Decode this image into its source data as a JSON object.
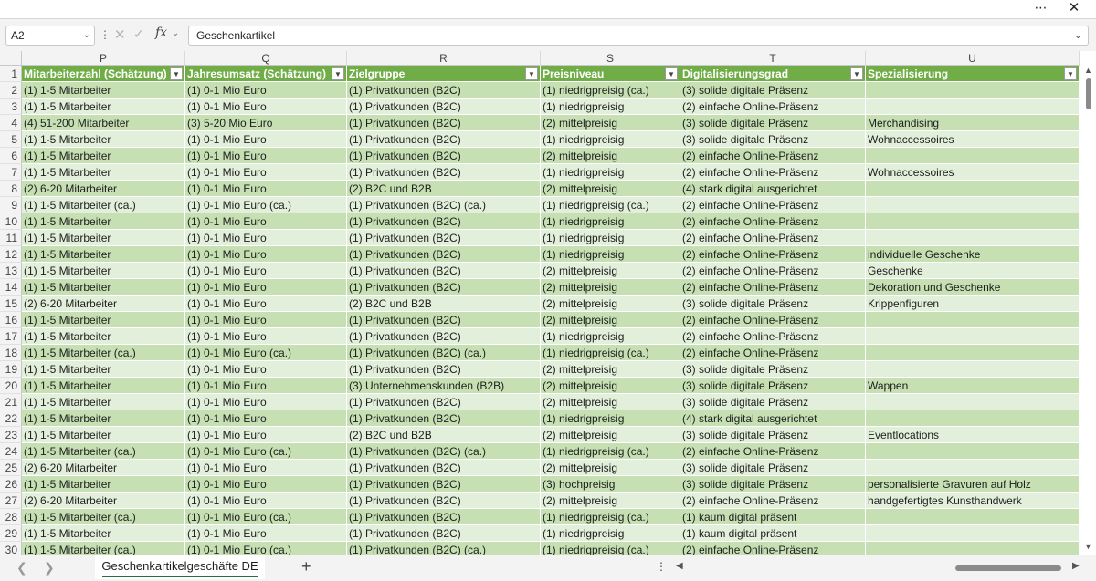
{
  "window": {
    "more_icon": "⋯",
    "close_icon": "✕"
  },
  "formula_bar": {
    "name_box": "A2",
    "fx_label": "fx",
    "content": "Geschenkartikel"
  },
  "columns": [
    "P",
    "Q",
    "R",
    "S",
    "T",
    "U"
  ],
  "headers": [
    "Mitarbeiterzahl (Schätzung)",
    "Jahresumsatz (Schätzung)",
    "Zielgruppe",
    "Preisniveau",
    "Digitalisierungsgrad",
    "Spezialisierung"
  ],
  "rows": [
    {
      "n": "2",
      "c": [
        "(1) 1-5 Mitarbeiter",
        "(1) 0-1 Mio Euro",
        "(1) Privatkunden (B2C)",
        "(1) niedrigpreisig (ca.)",
        "(3) solide digitale Präsenz",
        ""
      ]
    },
    {
      "n": "3",
      "c": [
        "(1) 1-5 Mitarbeiter",
        "(1) 0-1 Mio Euro",
        "(1) Privatkunden (B2C)",
        "(1) niedrigpreisig",
        "(2) einfache Online-Präsenz",
        ""
      ]
    },
    {
      "n": "4",
      "c": [
        "(4) 51-200 Mitarbeiter",
        "(3) 5-20 Mio Euro",
        "(1) Privatkunden (B2C)",
        "(2) mittelpreisig",
        "(3) solide digitale Präsenz",
        "Merchandising"
      ]
    },
    {
      "n": "5",
      "c": [
        "(1) 1-5 Mitarbeiter",
        "(1) 0-1 Mio Euro",
        "(1) Privatkunden (B2C)",
        "(1) niedrigpreisig",
        "(3) solide digitale Präsenz",
        "Wohnaccessoires"
      ]
    },
    {
      "n": "6",
      "c": [
        "(1) 1-5 Mitarbeiter",
        "(1) 0-1 Mio Euro",
        "(1) Privatkunden (B2C)",
        "(2) mittelpreisig",
        "(2) einfache Online-Präsenz",
        ""
      ]
    },
    {
      "n": "7",
      "c": [
        "(1) 1-5 Mitarbeiter",
        "(1) 0-1 Mio Euro",
        "(1) Privatkunden (B2C)",
        "(1) niedrigpreisig",
        "(2) einfache Online-Präsenz",
        "Wohnaccessoires"
      ]
    },
    {
      "n": "8",
      "c": [
        "(2) 6-20 Mitarbeiter",
        "(1) 0-1 Mio Euro",
        "(2) B2C und B2B",
        "(2) mittelpreisig",
        "(4) stark digital ausgerichtet",
        ""
      ]
    },
    {
      "n": "9",
      "c": [
        "(1) 1-5 Mitarbeiter (ca.)",
        "(1) 0-1 Mio Euro (ca.)",
        "(1) Privatkunden (B2C) (ca.)",
        "(1) niedrigpreisig (ca.)",
        "(2) einfache Online-Präsenz",
        ""
      ]
    },
    {
      "n": "10",
      "c": [
        "(1) 1-5 Mitarbeiter",
        "(1) 0-1 Mio Euro",
        "(1) Privatkunden (B2C)",
        "(1) niedrigpreisig",
        "(2) einfache Online-Präsenz",
        ""
      ]
    },
    {
      "n": "11",
      "c": [
        "(1) 1-5 Mitarbeiter",
        "(1) 0-1 Mio Euro",
        "(1) Privatkunden (B2C)",
        "(1) niedrigpreisig",
        "(2) einfache Online-Präsenz",
        ""
      ]
    },
    {
      "n": "12",
      "c": [
        "(1) 1-5 Mitarbeiter",
        "(1) 0-1 Mio Euro",
        "(1) Privatkunden (B2C)",
        "(1) niedrigpreisig",
        "(2) einfache Online-Präsenz",
        "individuelle Geschenke"
      ]
    },
    {
      "n": "13",
      "c": [
        "(1) 1-5 Mitarbeiter",
        "(1) 0-1 Mio Euro",
        "(1) Privatkunden (B2C)",
        "(2) mittelpreisig",
        "(2) einfache Online-Präsenz",
        "Geschenke"
      ]
    },
    {
      "n": "14",
      "c": [
        "(1) 1-5 Mitarbeiter",
        "(1) 0-1 Mio Euro",
        "(1) Privatkunden (B2C)",
        "(2) mittelpreisig",
        "(2) einfache Online-Präsenz",
        "Dekoration und Geschenke"
      ]
    },
    {
      "n": "15",
      "c": [
        "(2) 6-20 Mitarbeiter",
        "(1) 0-1 Mio Euro",
        "(2) B2C und B2B",
        "(2) mittelpreisig",
        "(3) solide digitale Präsenz",
        "Krippenfiguren"
      ]
    },
    {
      "n": "16",
      "c": [
        "(1) 1-5 Mitarbeiter",
        "(1) 0-1 Mio Euro",
        "(1) Privatkunden (B2C)",
        "(2) mittelpreisig",
        "(2) einfache Online-Präsenz",
        ""
      ]
    },
    {
      "n": "17",
      "c": [
        "(1) 1-5 Mitarbeiter",
        "(1) 0-1 Mio Euro",
        "(1) Privatkunden (B2C)",
        "(1) niedrigpreisig",
        "(2) einfache Online-Präsenz",
        ""
      ]
    },
    {
      "n": "18",
      "c": [
        "(1) 1-5 Mitarbeiter (ca.)",
        "(1) 0-1 Mio Euro (ca.)",
        "(1) Privatkunden (B2C) (ca.)",
        "(1) niedrigpreisig (ca.)",
        "(2) einfache Online-Präsenz",
        ""
      ]
    },
    {
      "n": "19",
      "c": [
        "(1) 1-5 Mitarbeiter",
        "(1) 0-1 Mio Euro",
        "(1) Privatkunden (B2C)",
        "(2) mittelpreisig",
        "(3) solide digitale Präsenz",
        ""
      ]
    },
    {
      "n": "20",
      "c": [
        "(1) 1-5 Mitarbeiter",
        "(1) 0-1 Mio Euro",
        "(3) Unternehmenskunden (B2B)",
        "(2) mittelpreisig",
        "(3) solide digitale Präsenz",
        "Wappen"
      ]
    },
    {
      "n": "21",
      "c": [
        "(1) 1-5 Mitarbeiter",
        "(1) 0-1 Mio Euro",
        "(1) Privatkunden (B2C)",
        "(2) mittelpreisig",
        "(3) solide digitale Präsenz",
        ""
      ]
    },
    {
      "n": "22",
      "c": [
        "(1) 1-5 Mitarbeiter",
        "(1) 0-1 Mio Euro",
        "(1) Privatkunden (B2C)",
        "(1) niedrigpreisig",
        "(4) stark digital ausgerichtet",
        ""
      ]
    },
    {
      "n": "23",
      "c": [
        "(1) 1-5 Mitarbeiter",
        "(1) 0-1 Mio Euro",
        "(2) B2C und B2B",
        "(2) mittelpreisig",
        "(3) solide digitale Präsenz",
        "Eventlocations"
      ]
    },
    {
      "n": "24",
      "c": [
        "(1) 1-5 Mitarbeiter (ca.)",
        "(1) 0-1 Mio Euro (ca.)",
        "(1) Privatkunden (B2C) (ca.)",
        "(1) niedrigpreisig (ca.)",
        "(2) einfache Online-Präsenz",
        ""
      ]
    },
    {
      "n": "25",
      "c": [
        "(2) 6-20 Mitarbeiter",
        "(1) 0-1 Mio Euro",
        "(1) Privatkunden (B2C)",
        "(2) mittelpreisig",
        "(3) solide digitale Präsenz",
        ""
      ]
    },
    {
      "n": "26",
      "c": [
        "(1) 1-5 Mitarbeiter",
        "(1) 0-1 Mio Euro",
        "(1) Privatkunden (B2C)",
        "(3) hochpreisig",
        "(3) solide digitale Präsenz",
        "personalisierte Gravuren auf Holz"
      ]
    },
    {
      "n": "27",
      "c": [
        "(2) 6-20 Mitarbeiter",
        "(1) 0-1 Mio Euro",
        "(1) Privatkunden (B2C)",
        "(2) mittelpreisig",
        "(2) einfache Online-Präsenz",
        "handgefertigtes Kunsthandwerk"
      ]
    },
    {
      "n": "28",
      "c": [
        "(1) 1-5 Mitarbeiter (ca.)",
        "(1) 0-1 Mio Euro (ca.)",
        "(1) Privatkunden (B2C)",
        "(1) niedrigpreisig (ca.)",
        "(1) kaum digital präsent",
        ""
      ]
    },
    {
      "n": "29",
      "c": [
        "(1) 1-5 Mitarbeiter",
        "(1) 0-1 Mio Euro",
        "(1) Privatkunden (B2C)",
        "(1) niedrigpreisig",
        "(1) kaum digital präsent",
        ""
      ]
    },
    {
      "n": "30",
      "c": [
        "(1) 1-5 Mitarbeiter (ca.)",
        "(1) 0-1 Mio Euro (ca.)",
        "(1) Privatkunden (B2C) (ca.)",
        "(1) niedrigpreisig (ca.)",
        "(2) einfache Online-Präsenz",
        ""
      ]
    }
  ],
  "sheet_tabs": [
    {
      "label": "Geschenkartikelgeschäfte DE",
      "active": true
    }
  ],
  "colors": {
    "header_green": "#70ad47",
    "band_dark": "#c6e0b4",
    "band_light": "#e2efda",
    "accent": "#217346"
  }
}
